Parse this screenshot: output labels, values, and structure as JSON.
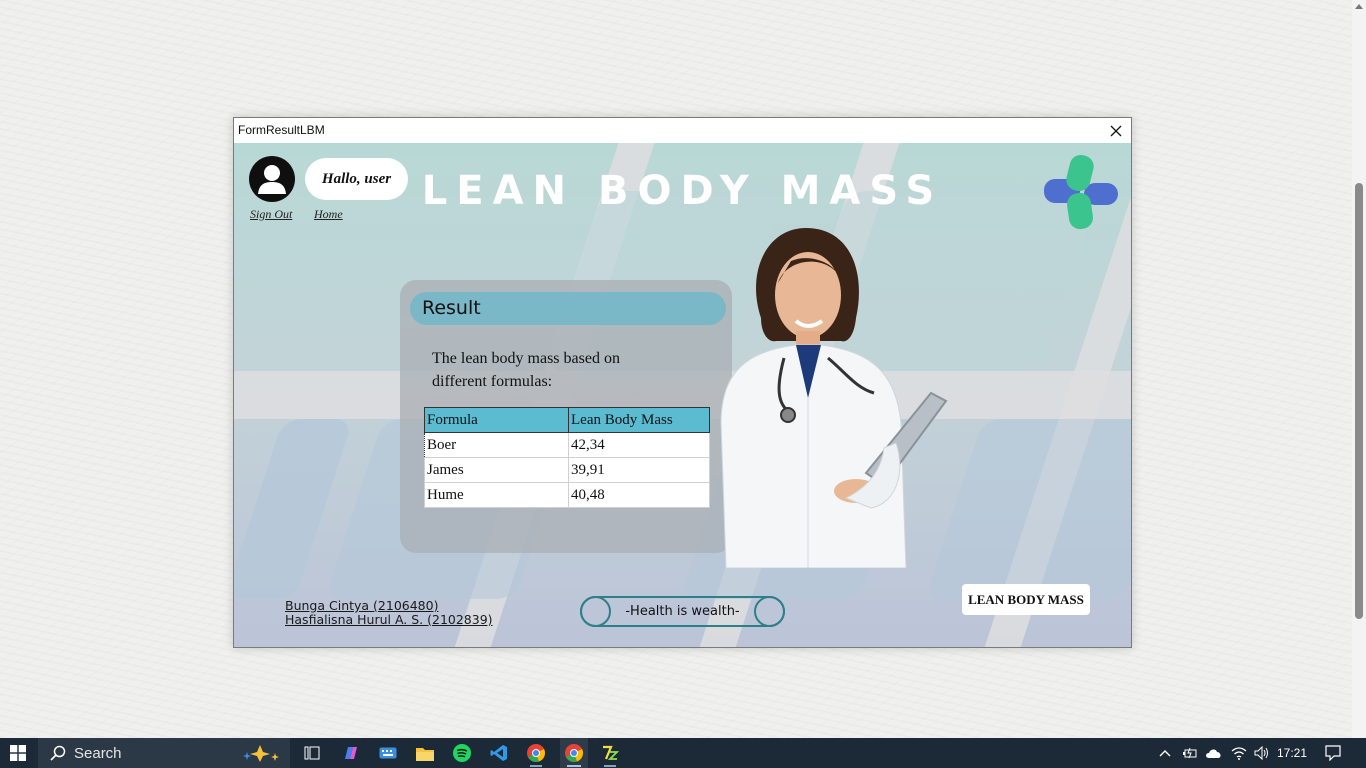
{
  "window": {
    "title": "FormResultLBM"
  },
  "header": {
    "greeting": "Hallo, user",
    "sign_out": "Sign Out",
    "home": "Home",
    "heading": "LEAN BODY MASS"
  },
  "result": {
    "title": "Result",
    "description": "The lean body mass based on different formulas:",
    "columns": [
      "Formula",
      "Lean Body Mass"
    ],
    "rows": [
      {
        "formula": "Boer",
        "value": "42,34"
      },
      {
        "formula": "James",
        "value": "39,91"
      },
      {
        "formula": "Hume",
        "value": "40,48"
      }
    ]
  },
  "footer": {
    "credit_1": "Bunga Cintya (2106480)",
    "credit_2": "Hasfialisna Hurul A. S. (2102839)",
    "motto": "-Health is wealth-",
    "lbm_button": "LEAN BODY MASS"
  },
  "taskbar": {
    "search_label": "Search",
    "time": "17:21"
  },
  "colors": {
    "result_header": "#7ab8c8",
    "table_header": "#5bbbd1",
    "logo_blue": "#4f6fd0",
    "logo_green": "#3cc48e",
    "taskbar": "#1c2a38"
  }
}
